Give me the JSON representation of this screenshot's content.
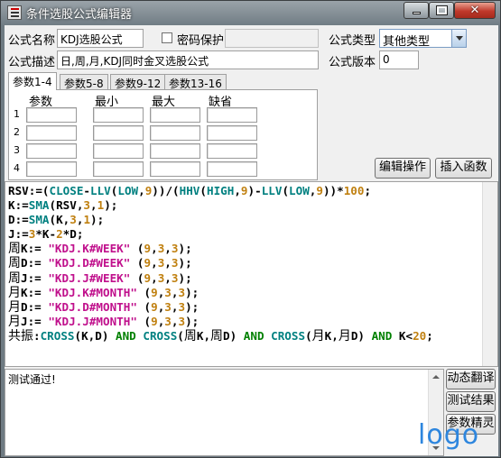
{
  "window": {
    "title": "条件选股公式编辑器",
    "controls": {
      "close": "✕"
    }
  },
  "form": {
    "name_label": "公式名称",
    "name_value": "KDJ选股公式",
    "password_label": "密码保护",
    "password_checked": false,
    "type_label": "公式类型",
    "type_value": "其他类型",
    "desc_label": "公式描述",
    "desc_value": "日,周,月,KDJ同时金叉选股公式",
    "version_label": "公式版本",
    "version_value": "0"
  },
  "tabs": [
    "参数1-4",
    "参数5-8",
    "参数9-12",
    "参数13-16"
  ],
  "param_table": {
    "headers": [
      "参数",
      "最小",
      "最大",
      "缺省"
    ],
    "rows": [
      "1",
      "2",
      "3",
      "4"
    ]
  },
  "buttons": {
    "edit_ops": "编辑操作",
    "insert_func": "插入函数",
    "translate": "动态翻译",
    "test_result": "测试结果",
    "param_wizard": "参数精灵"
  },
  "code_lines": [
    [
      [
        "d",
        "RSV:=("
      ],
      [
        "f",
        "CLOSE"
      ],
      [
        "d",
        "-"
      ],
      [
        "f",
        "LLV"
      ],
      [
        "d",
        "("
      ],
      [
        "f",
        "LOW"
      ],
      [
        "d",
        ","
      ],
      [
        "n",
        "9"
      ],
      [
        "d",
        "))/("
      ],
      [
        "f",
        "HHV"
      ],
      [
        "d",
        "("
      ],
      [
        "f",
        "HIGH"
      ],
      [
        "d",
        ","
      ],
      [
        "n",
        "9"
      ],
      [
        "d",
        ")-"
      ],
      [
        "f",
        "LLV"
      ],
      [
        "d",
        "("
      ],
      [
        "f",
        "LOW"
      ],
      [
        "d",
        ","
      ],
      [
        "n",
        "9"
      ],
      [
        "d",
        "))*"
      ],
      [
        "n",
        "100"
      ],
      [
        "d",
        ";"
      ]
    ],
    [
      [
        "d",
        "K:="
      ],
      [
        "f",
        "SMA"
      ],
      [
        "d",
        "(RSV,"
      ],
      [
        "n",
        "3"
      ],
      [
        "d",
        ","
      ],
      [
        "n",
        "1"
      ],
      [
        "d",
        ");"
      ]
    ],
    [
      [
        "d",
        "D:="
      ],
      [
        "f",
        "SMA"
      ],
      [
        "d",
        "(K,"
      ],
      [
        "n",
        "3"
      ],
      [
        "d",
        ","
      ],
      [
        "n",
        "1"
      ],
      [
        "d",
        ");"
      ]
    ],
    [
      [
        "d",
        "J:="
      ],
      [
        "n",
        "3"
      ],
      [
        "d",
        "*K-"
      ],
      [
        "n",
        "2"
      ],
      [
        "d",
        "*D;"
      ]
    ],
    [
      [
        "cn",
        "周"
      ],
      [
        "d",
        "K:= "
      ],
      [
        "s",
        "\"KDJ.K#WEEK\""
      ],
      [
        "d",
        " ("
      ],
      [
        "n",
        "9"
      ],
      [
        "d",
        ","
      ],
      [
        "n",
        "3"
      ],
      [
        "d",
        ","
      ],
      [
        "n",
        "3"
      ],
      [
        "d",
        ");"
      ]
    ],
    [
      [
        "cn",
        "周"
      ],
      [
        "d",
        "D:= "
      ],
      [
        "s",
        "\"KDJ.D#WEEK\""
      ],
      [
        "d",
        " ("
      ],
      [
        "n",
        "9"
      ],
      [
        "d",
        ","
      ],
      [
        "n",
        "3"
      ],
      [
        "d",
        ","
      ],
      [
        "n",
        "3"
      ],
      [
        "d",
        ");"
      ]
    ],
    [
      [
        "cn",
        "周"
      ],
      [
        "d",
        "J:= "
      ],
      [
        "s",
        "\"KDJ.J#WEEK\""
      ],
      [
        "d",
        " ("
      ],
      [
        "n",
        "9"
      ],
      [
        "d",
        ","
      ],
      [
        "n",
        "3"
      ],
      [
        "d",
        ","
      ],
      [
        "n",
        "3"
      ],
      [
        "d",
        ");"
      ]
    ],
    [
      [
        "cn",
        "月"
      ],
      [
        "d",
        "K:= "
      ],
      [
        "s",
        "\"KDJ.K#MONTH\""
      ],
      [
        "d",
        " ("
      ],
      [
        "n",
        "9"
      ],
      [
        "d",
        ","
      ],
      [
        "n",
        "3"
      ],
      [
        "d",
        ","
      ],
      [
        "n",
        "3"
      ],
      [
        "d",
        ");"
      ]
    ],
    [
      [
        "cn",
        "月"
      ],
      [
        "d",
        "D:= "
      ],
      [
        "s",
        "\"KDJ.D#MONTH\""
      ],
      [
        "d",
        " ("
      ],
      [
        "n",
        "9"
      ],
      [
        "d",
        ","
      ],
      [
        "n",
        "3"
      ],
      [
        "d",
        ","
      ],
      [
        "n",
        "3"
      ],
      [
        "d",
        ");"
      ]
    ],
    [
      [
        "cn",
        "月"
      ],
      [
        "d",
        "J:= "
      ],
      [
        "s",
        "\"KDJ.J#MONTH\""
      ],
      [
        "d",
        " ("
      ],
      [
        "n",
        "9"
      ],
      [
        "d",
        ","
      ],
      [
        "n",
        "3"
      ],
      [
        "d",
        ","
      ],
      [
        "n",
        "3"
      ],
      [
        "d",
        ");"
      ]
    ],
    [
      [
        "cn",
        "共振"
      ],
      [
        "d",
        ":"
      ],
      [
        "f",
        "CROSS"
      ],
      [
        "d",
        "(K,D) "
      ],
      [
        "k",
        "AND"
      ],
      [
        "d",
        " "
      ],
      [
        "f",
        "CROSS"
      ],
      [
        "d",
        "("
      ],
      [
        "cn",
        "周"
      ],
      [
        "d",
        "K,"
      ],
      [
        "cn",
        "周"
      ],
      [
        "d",
        "D) "
      ],
      [
        "k",
        "AND"
      ],
      [
        "d",
        " "
      ],
      [
        "f",
        "CROSS"
      ],
      [
        "d",
        "("
      ],
      [
        "cn",
        "月"
      ],
      [
        "d",
        "K,"
      ],
      [
        "cn",
        "月"
      ],
      [
        "d",
        "D) "
      ],
      [
        "k",
        "AND"
      ],
      [
        "d",
        " K<"
      ],
      [
        "n",
        "20"
      ],
      [
        "d",
        ";"
      ]
    ]
  ],
  "output_text": "测试通过!",
  "watermark": "logo",
  "colors": {
    "function": "#008080",
    "string": "#c0108c",
    "number": "#c08010",
    "keyword": "#008000"
  }
}
